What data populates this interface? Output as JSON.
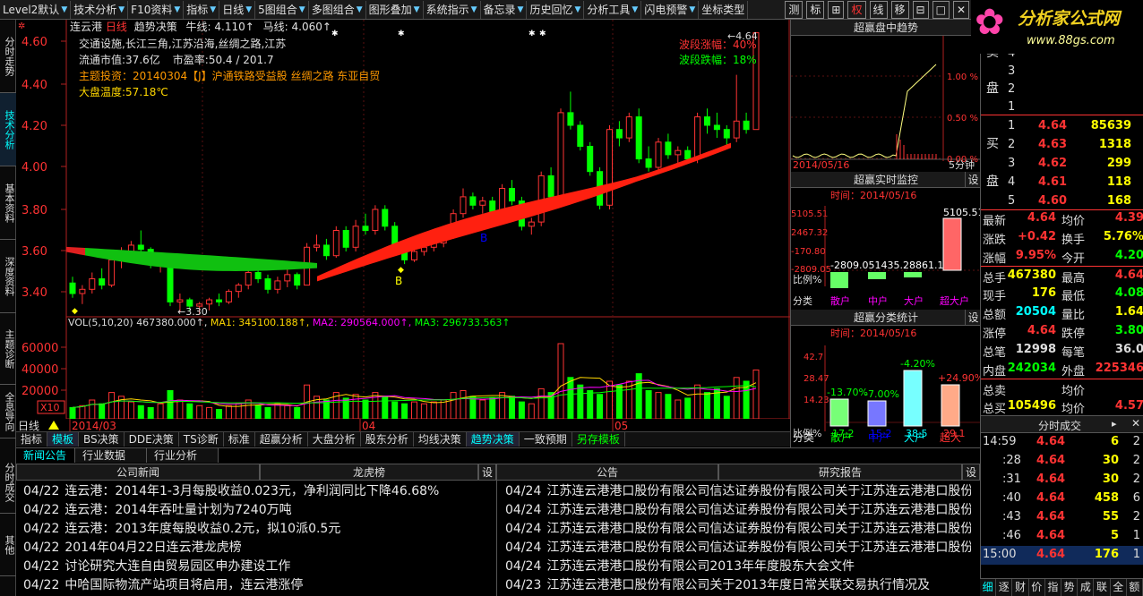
{
  "toolbar": {
    "items": [
      "Level2默认",
      "技术分析",
      "F10资料",
      "指标",
      "日线",
      "5图组合",
      "多图组合",
      "图形叠加",
      "系统指示",
      "备忘录",
      "历史回忆",
      "分析工具",
      "闪电预警",
      "坐标类型"
    ],
    "right_items": [
      "测",
      "标",
      "⊞",
      "权",
      "线",
      "移",
      "⊟",
      "□",
      "✕"
    ]
  },
  "logo": {
    "brand": "分析家公式网",
    "url": "www.88gs.com"
  },
  "leftnav": [
    "分时走势",
    "技术分析",
    "基本资料",
    "深度资料",
    "主题诊断",
    "全息导向"
  ],
  "leftnav_lower": [
    "分时成交",
    "其他"
  ],
  "stock": {
    "name": "连云港",
    "period": "日线",
    "indicator": "趋势决策",
    "niu_label": "牛线: 4.110↑",
    "ma_label": "马线: 4.060↑"
  },
  "info": {
    "concepts": "交通设施,长江三角,江苏沿海,丝绸之路,江苏",
    "float_cap_label": "流通市值:",
    "float_cap": "37.6亿",
    "pe_label": "市盈率:",
    "pe": "50.4 / 201.7",
    "theme_label": "主题投资：",
    "theme": "20140304【J】沪通铁路受益股 丝绸之路 东亚自贸",
    "temp_label": "大盘温度:",
    "temp": "57.18℃"
  },
  "wave": {
    "up_label": "波段涨幅：",
    "up": "40%",
    "down_label": "波段跌幅：",
    "down": "18%"
  },
  "price_axis": [
    "4.60",
    "4.40",
    "4.20",
    "4.00",
    "3.80",
    "3.60",
    "3.40"
  ],
  "annotations": {
    "high": "4.64",
    "low": "3.30",
    "buy1": "B",
    "buy2": "B"
  },
  "vol": {
    "label": "VOL(5,10,20)",
    "vol": "467380.000↑",
    "ma1": "MA1: 345100.188↑",
    "ma2": "MA2: 290564.000↑",
    "ma3": "MA3: 296733.563↑",
    "axis": [
      "60000",
      "40000",
      "20000"
    ],
    "unit": "X10"
  },
  "date_axis": {
    "period": "日线",
    "labels": [
      "2014/03",
      "04",
      "05"
    ]
  },
  "bottom_tabs": [
    "指标",
    "模板",
    "BS决策",
    "DDE决策",
    "TS诊断",
    "标准",
    "超赢分析",
    "大盘分析",
    "股东分析",
    "均线决策",
    "趋势决策",
    "一致预期",
    "另存模板"
  ],
  "trend_panel": {
    "title": "超赢盘中趋势",
    "axis": [
      "1.00 %",
      "0.50 %",
      "0.00 %"
    ],
    "date": "2014/05/16",
    "period": "5分钟"
  },
  "monitor_panel": {
    "title": "超赢实时监控",
    "set": "设",
    "time_label": "时间：2014/05/16",
    "axis": [
      "5105.51",
      "2467.32",
      "-170.80",
      "-2809.05"
    ],
    "values_line": "-2809.051435.28861.17",
    "top_value": "5105.51",
    "ratio_label": "比例%",
    "cat_label": "分类",
    "categories": [
      "散户",
      "中户",
      "大户",
      "超大户"
    ]
  },
  "class_panel": {
    "title": "超赢分类统计",
    "set": "设",
    "time_label": "时间：2014/05/16",
    "axis": [
      "42.7",
      "28.47",
      "14.23"
    ],
    "pcts": [
      "-13.70%",
      "-7.00%",
      "-4.20%",
      "+24.90%"
    ],
    "ratios": [
      "17.2",
      "15.2",
      "38.5",
      "29.1"
    ],
    "ratio_label": "比例%",
    "cat_label": "分类",
    "categories": [
      "散户",
      "中户",
      "大户",
      "超大"
    ]
  },
  "orderbook": {
    "sell_label": "卖",
    "sell_side": "盘",
    "buy_label": "买",
    "buy_side": "盘",
    "sell_indices": [
      "4",
      "3",
      "2",
      "1"
    ],
    "buy": [
      {
        "i": "1",
        "p": "4.64",
        "v": "85639"
      },
      {
        "i": "2",
        "p": "4.63",
        "v": "1318"
      },
      {
        "i": "3",
        "p": "4.62",
        "v": "299"
      },
      {
        "i": "4",
        "p": "4.61",
        "v": "118"
      },
      {
        "i": "5",
        "p": "4.60",
        "v": "168"
      }
    ]
  },
  "quote": [
    {
      "l": "最新",
      "v": "4.64",
      "c": "#f33",
      "l2": "均价",
      "v2": "4.39",
      "c2": "#f33"
    },
    {
      "l": "涨跌",
      "v": "+0.42",
      "c": "#f33",
      "l2": "换手",
      "v2": "5.76%",
      "c2": "#ff0"
    },
    {
      "l": "涨幅",
      "v": "9.95%",
      "c": "#f33",
      "l2": "今开",
      "v2": "4.20",
      "c2": "#0f0"
    },
    {
      "l": "总手",
      "v": "467380",
      "c": "#ff0",
      "l2": "最高",
      "v2": "4.64",
      "c2": "#f33"
    },
    {
      "l": "现手",
      "v": "176",
      "c": "#ff0",
      "l2": "最低",
      "v2": "4.08",
      "c2": "#0f0"
    },
    {
      "l": "总额",
      "v": "20504",
      "c": "#0ff",
      "l2": "量比",
      "v2": "1.64",
      "c2": "#ff0"
    },
    {
      "l": "涨停",
      "v": "4.64",
      "c": "#f33",
      "l2": "跌停",
      "v2": "3.80",
      "c2": "#0f0"
    },
    {
      "l": "总笔",
      "v": "12998",
      "c": "#ddd",
      "l2": "每笔",
      "v2": "36.0",
      "c2": "#ddd"
    },
    {
      "l": "内盘",
      "v": "242034",
      "c": "#0f0",
      "l2": "外盘",
      "v2": "225346",
      "c2": "#f33"
    },
    {
      "l": "总卖",
      "v": "",
      "c": "#ddd",
      "l2": "均价",
      "v2": "",
      "c2": "#ddd"
    },
    {
      "l": "总买",
      "v": "105496",
      "c": "#ff0",
      "l2": "均价",
      "v2": "4.57",
      "c2": "#f33"
    }
  ],
  "trades_panel": {
    "title": "分时成交",
    "close": "✕"
  },
  "trades": [
    {
      "t": "14:59",
      "p": "4.64",
      "v": "6",
      "n": "2"
    },
    {
      "t": ":28",
      "p": "4.64",
      "v": "30",
      "n": "2"
    },
    {
      "t": ":31",
      "p": "4.64",
      "v": "30",
      "n": "2"
    },
    {
      "t": ":40",
      "p": "4.64",
      "v": "458",
      "n": "6"
    },
    {
      "t": ":43",
      "p": "4.64",
      "v": "55",
      "n": "2"
    },
    {
      "t": ":46",
      "p": "4.64",
      "v": "5",
      "n": "1"
    },
    {
      "t": "15:00",
      "p": "4.64",
      "v": "176",
      "n": "1"
    }
  ],
  "bottom_right_tabs": [
    "细",
    "逐",
    "财",
    "价",
    "指",
    "势",
    "成",
    "联",
    "全",
    "额"
  ],
  "news": {
    "tabs": [
      "新闻公告",
      "行业数据",
      "行业分析"
    ],
    "heads": [
      "公司新闻",
      "龙虎榜",
      "公告",
      "研究报告"
    ],
    "set": "设",
    "left": [
      {
        "d": "04/22",
        "t": "连云港：2014年1-3月每股收益0.023元，净利润同比下降46.68%"
      },
      {
        "d": "04/22",
        "t": "连云港：2014年吞吐量计划为7240万吨"
      },
      {
        "d": "04/22",
        "t": "连云港：2013年度每股收益0.2元，拟10派0.5元"
      },
      {
        "d": "04/22",
        "t": "2014年04月22日连云港龙虎榜"
      },
      {
        "d": "04/22",
        "t": "讨论研究大连自由贸易园区申办建设工作"
      },
      {
        "d": "04/22",
        "t": "中哈国际物流产站项目将启用，连云港涨停"
      }
    ],
    "right": [
      {
        "d": "04/24",
        "t": "江苏连云港港口股份有限公司信达证券股份有限公司关于江苏连云港港口股份有限公司"
      },
      {
        "d": "04/24",
        "t": "江苏连云港港口股份有限公司信达证券股份有限公司关于江苏连云港港口股份有限公司"
      },
      {
        "d": "04/24",
        "t": "江苏连云港港口股份有限公司信达证券股份有限公司关于江苏连云港港口股份有限公司"
      },
      {
        "d": "04/24",
        "t": "江苏连云港港口股份有限公司信达证券股份有限公司关于江苏连云港港口股份有限公司"
      },
      {
        "d": "04/24",
        "t": "江苏连云港港口股份有限公司2013年年度股东大会文件"
      },
      {
        "d": "04/23",
        "t": "江苏连云港港口股份有限公司关于2013年度日常关联交易执行情况及"
      }
    ]
  },
  "colors": {
    "up": "#ff3333",
    "down": "#00ff00",
    "accent": "#00ffff",
    "ma_yellow": "#ffd700",
    "ma_pink": "#ff00ff"
  }
}
